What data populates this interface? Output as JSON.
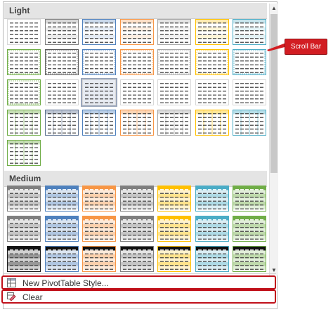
{
  "gallery": {
    "sections": [
      {
        "label": "Light"
      },
      {
        "label": "Medium"
      }
    ],
    "light_tiles": [
      {
        "color": "#7f7f7f",
        "style": "plain"
      },
      {
        "color": "#7f7f7f",
        "style": "band"
      },
      {
        "color": "#4f81bd",
        "style": "band"
      },
      {
        "color": "#f79646",
        "style": "band"
      },
      {
        "color": "#a5a5a5",
        "style": "band"
      },
      {
        "color": "#ffc000",
        "style": "band"
      },
      {
        "color": "#4bacc6",
        "style": "band"
      },
      {
        "color": "#70ad47",
        "style": "border"
      },
      {
        "color": "#595959",
        "style": "border"
      },
      {
        "color": "#4f81bd",
        "style": "border"
      },
      {
        "color": "#f79646",
        "style": "border"
      },
      {
        "color": "#a5a5a5",
        "style": "border"
      },
      {
        "color": "#ffc000",
        "style": "border"
      },
      {
        "color": "#4bacc6",
        "style": "border"
      },
      {
        "color": "#70ad47",
        "style": "border"
      },
      {
        "color": "#7f7f7f",
        "style": "plain"
      },
      {
        "color": "#7f7f7f",
        "style": "selected"
      },
      {
        "color": "#7f7f7f",
        "style": "plain"
      },
      {
        "color": "#7f7f7f",
        "style": "plain"
      },
      {
        "color": "#7f7f7f",
        "style": "plain"
      },
      {
        "color": "#7f7f7f",
        "style": "plain"
      },
      {
        "color": "#70ad47",
        "style": "grid"
      },
      {
        "color": "#5b6f8f",
        "style": "grid"
      },
      {
        "color": "#4f81bd",
        "style": "grid"
      },
      {
        "color": "#f79646",
        "style": "grid"
      },
      {
        "color": "#a5a5a5",
        "style": "grid"
      },
      {
        "color": "#ffc000",
        "style": "grid"
      },
      {
        "color": "#4bacc6",
        "style": "grid"
      },
      {
        "color": "#70ad47",
        "style": "grid"
      }
    ],
    "medium_tiles": [
      {
        "color": "#7f7f7f",
        "style": "header"
      },
      {
        "color": "#4f81bd",
        "style": "header"
      },
      {
        "color": "#f79646",
        "style": "header"
      },
      {
        "color": "#7f7f7f",
        "style": "header"
      },
      {
        "color": "#ffc000",
        "style": "header"
      },
      {
        "color": "#4bacc6",
        "style": "header"
      },
      {
        "color": "#70ad47",
        "style": "header"
      },
      {
        "color": "#7f7f7f",
        "style": "header"
      },
      {
        "color": "#4f81bd",
        "style": "header"
      },
      {
        "color": "#f79646",
        "style": "header"
      },
      {
        "color": "#7f7f7f",
        "style": "header"
      },
      {
        "color": "#ffc000",
        "style": "header"
      },
      {
        "color": "#4bacc6",
        "style": "header"
      },
      {
        "color": "#70ad47",
        "style": "header"
      },
      {
        "color": "#1a1a1a",
        "style": "dark"
      },
      {
        "color": "#4f81bd",
        "style": "dark"
      },
      {
        "color": "#f79646",
        "style": "dark"
      },
      {
        "color": "#7f7f7f",
        "style": "dark"
      },
      {
        "color": "#ffc000",
        "style": "dark"
      },
      {
        "color": "#4bacc6",
        "style": "dark"
      },
      {
        "color": "#70ad47",
        "style": "dark"
      }
    ]
  },
  "scrollbar": {
    "up_icon": "up-arrow-icon",
    "down_icon": "down-arrow-icon"
  },
  "callout": {
    "label": "Scroll Bar",
    "color": "#d21d22"
  },
  "menu": {
    "new_style": {
      "label": "New PivotTable Style...",
      "icon": "new-style-icon"
    },
    "clear": {
      "label": "Clear",
      "icon": "eraser-icon"
    }
  },
  "highlight_color": "#c0101a"
}
